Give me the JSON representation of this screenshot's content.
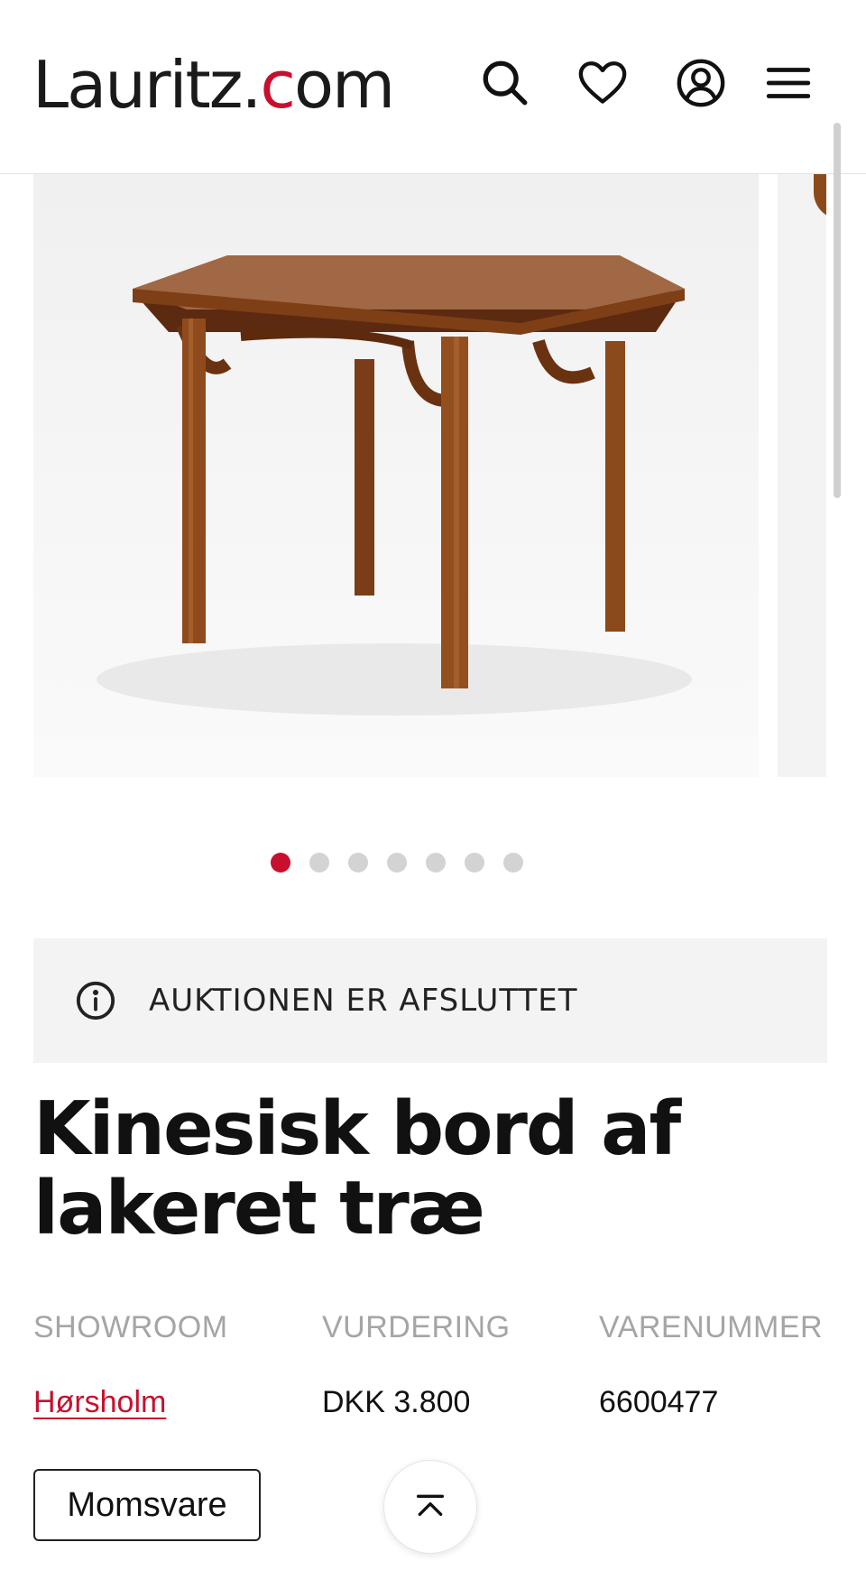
{
  "header": {
    "logo_text_left": "Lauritz.",
    "logo_text_c": "c",
    "logo_text_right": "om",
    "icons": [
      "search-icon",
      "heart-icon",
      "account-icon",
      "menu-icon"
    ]
  },
  "gallery": {
    "image_alt": "Kinesisk bord af lakeret træ",
    "dot_count": 7,
    "active_index": 0
  },
  "notice": {
    "icon": "info-icon",
    "text": "AUKTIONEN ER AFSLUTTET"
  },
  "product": {
    "title": "Kinesisk bord af lakeret træ"
  },
  "meta": {
    "showroom_label": "SHOWROOM",
    "showroom_value": "Hørsholm",
    "valuation_label": "VURDERING",
    "valuation_value": "DKK 3.800",
    "item_number_label": "VARENUMMER",
    "item_number_value": "6600477"
  },
  "actions": {
    "vat_label": "Momsvare",
    "scroll_top_icon": "chevron-up-icon"
  },
  "colors": {
    "accent": "#c8102e",
    "notice_bg": "#f3f3f3",
    "label_gray": "#a5a5a5"
  }
}
